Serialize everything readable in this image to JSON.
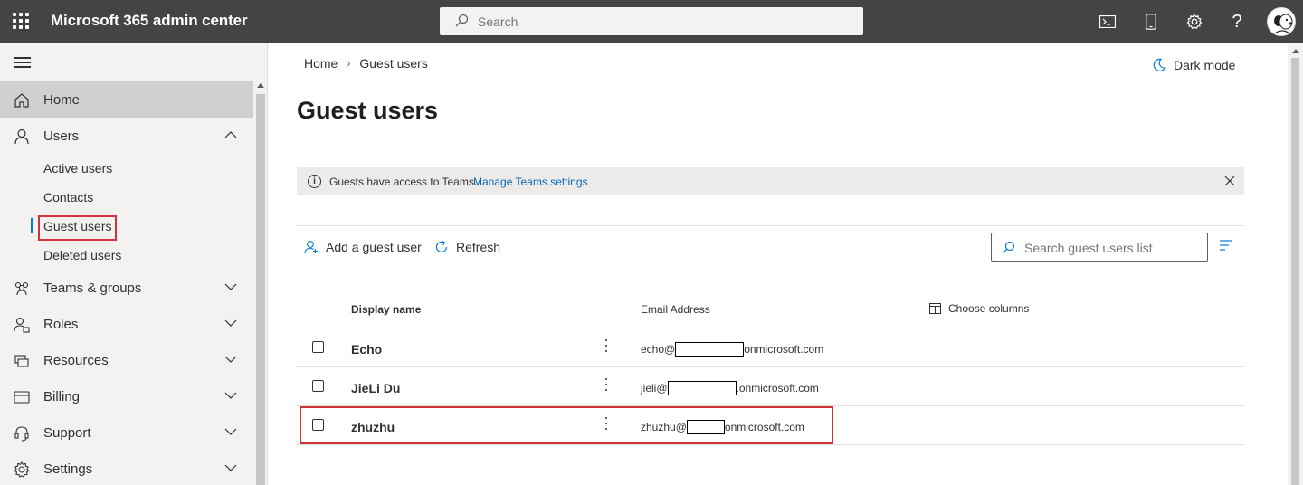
{
  "topbar": {
    "app_title": "Microsoft 365 admin center",
    "search_placeholder": "Search",
    "icons": [
      "waffle-icon",
      "terminal-icon",
      "mobile-icon",
      "gear-icon",
      "help-icon",
      "avatar"
    ]
  },
  "nav": {
    "items": [
      {
        "label": "Home",
        "icon": "home-icon",
        "selected": true
      },
      {
        "label": "Users",
        "icon": "person-icon",
        "expanded": true,
        "children": [
          "Active users",
          "Contacts",
          "Guest users",
          "Deleted users"
        ]
      },
      {
        "label": "Teams & groups",
        "icon": "people-icon"
      },
      {
        "label": "Roles",
        "icon": "roles-icon"
      },
      {
        "label": "Resources",
        "icon": "resources-icon"
      },
      {
        "label": "Billing",
        "icon": "billing-icon"
      },
      {
        "label": "Support",
        "icon": "headset-icon"
      },
      {
        "label": "Settings",
        "icon": "gear-icon"
      }
    ],
    "active_child": "Guest users"
  },
  "breadcrumb": [
    "Home",
    "Guest users"
  ],
  "dark_mode_label": "Dark mode",
  "page_title": "Guest users",
  "infobar": {
    "message": "Guests have access to Teams.",
    "link": "Manage Teams settings"
  },
  "commands": {
    "add_guest": "Add a guest user",
    "refresh": "Refresh",
    "search_placeholder": "Search guest users list"
  },
  "table": {
    "columns": [
      "Display name",
      "Email Address"
    ],
    "choose_columns": "Choose columns",
    "rows": [
      {
        "name": "Echo",
        "email_prefix": "echo@",
        "email_suffix": "onmicrosoft.com"
      },
      {
        "name": "JieLi Du",
        "email_prefix": "jieli@",
        "email_suffix": ".onmicrosoft.com"
      },
      {
        "name": "zhuzhu",
        "email_prefix": "zhuzhu@",
        "email_suffix": "onmicrosoft.com"
      }
    ]
  },
  "colors": {
    "topbar": "#444444",
    "accent": "#0078d4",
    "highlight": "#d13438",
    "link": "#0067b8"
  }
}
